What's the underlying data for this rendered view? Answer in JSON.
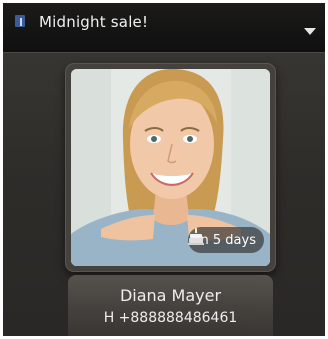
{
  "header": {
    "title": "Midnight sale!",
    "app_icon": "facebook-icon",
    "menu_icon": "dropdown-arrow-icon"
  },
  "contact": {
    "photo": "portrait-photo",
    "birthday_badge": "in 5 days",
    "badge_icon": "birthday-cake-icon",
    "name": "Diana Mayer",
    "phone": "H +888888486461"
  },
  "colors": {
    "background": "#2e2c29",
    "topbar": "#111111",
    "text": "#ffffff",
    "brand": "#3b5b99"
  }
}
